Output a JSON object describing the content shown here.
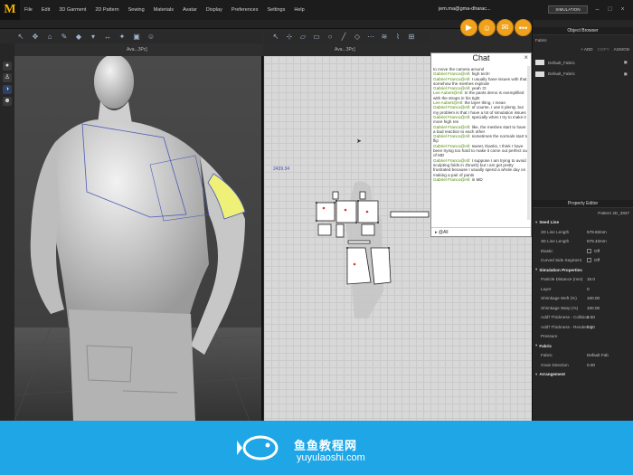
{
  "app": {
    "logo": "M"
  },
  "menu": [
    "File",
    "Edit",
    "3D Garment",
    "2D Pattern",
    "Sewing",
    "Materials",
    "Avatar",
    "Display",
    "Preferences",
    "Settings",
    "Help"
  ],
  "user_email": "jem.ma@gma-dharac...",
  "mode": "SIMULATION",
  "tabs": {
    "view3d": "Ava...3Pc]",
    "view2d": "Ava...3Pc]"
  },
  "chat": {
    "title": "Chat",
    "lines": [
      {
        "name": "",
        "text": "to move the camera around"
      },
      {
        "name": "Gabriel Franco@All:",
        "text": "high tech!"
      },
      {
        "name": "Gabriel Franco@All:",
        "text": "I usually have issues with that, somehow the meshes explode"
      },
      {
        "name": "Gabriel Franco@All:",
        "text": "yeah :D"
      },
      {
        "name": "Lee Aubert@All:",
        "text": "In the pants demo is exemplified with the straps in his tight"
      },
      {
        "name": "Lee Aubert@All:",
        "text": "the layer thing, I mean"
      },
      {
        "name": "Gabriel Franco@All:",
        "text": "of course, I use it plenty, but my problem is that I have a lot of simulation issues"
      },
      {
        "name": "Gabriel Franco@All:",
        "text": "specially when I try to make it more high res"
      },
      {
        "name": "Gabriel Franco@All:",
        "text": "like, the meshes start to have a bad reaction to each other"
      },
      {
        "name": "Gabriel Franco@All:",
        "text": "sometimes the normals start to flip"
      },
      {
        "name": "Gabriel Franco@All:",
        "text": "sweet, thanks, I think I have been trying too hard to make it come out perfect out of MD"
      },
      {
        "name": "Gabriel Franco@All:",
        "text": "I suppose I am trying to avoid sculpting folds in zbrush) but I am get pretty frustrated because I usually spend a whole day on making a pair of pants"
      },
      {
        "name": "Gabriel Franco@All:",
        "text": "in MD"
      }
    ],
    "input": "@All"
  },
  "object_browser": {
    "title": "Object Browser",
    "filter_label": "Fabric",
    "buttons": [
      "+ ADD",
      "COPY",
      "ASSIGN"
    ],
    "items": [
      "Default_Fabric",
      "Default_Fabric"
    ]
  },
  "property_editor": {
    "title": "Property Editor",
    "subtitle": "Pattern 2D_3837",
    "rows": [
      {
        "label": "Seed Line",
        "value": "",
        "section": true
      },
      {
        "label": "2D Line Length",
        "value": "579.82mm"
      },
      {
        "label": "3D Line Length",
        "value": "579.42mm"
      },
      {
        "label": "Elastic",
        "value": "Off"
      },
      {
        "label": "Curved Side Segment",
        "value": "Off"
      },
      {
        "label": "Simulation Properties",
        "value": "",
        "section": true
      },
      {
        "label": "Particle Distance (mm)",
        "value": "15.0"
      },
      {
        "label": "Layer",
        "value": "0"
      },
      {
        "label": "Shrinkage Weft (%)",
        "value": "100.00"
      },
      {
        "label": "Shrinkage Warp (%)",
        "value": "100.00"
      },
      {
        "label": "Add'l Thickness - Collision",
        "value": "2.50"
      },
      {
        "label": "Add'l Thickness - Rendering",
        "value": "0.00"
      },
      {
        "label": "Pressure",
        "value": ""
      },
      {
        "label": "Fabric",
        "value": "",
        "section": true
      },
      {
        "label": "Fabric",
        "value": "Default Fab"
      },
      {
        "label": "Grain Direction",
        "value": "0.00"
      },
      {
        "label": "Arrangement",
        "value": "",
        "section": true
      }
    ]
  },
  "coords_label": "2439.34",
  "watermark": {
    "title": "鱼鱼教程网",
    "url": "yuyulaoshi.com"
  },
  "colors": {
    "accent": "#f1a21c",
    "watermark_bg": "#1ea6e6"
  }
}
